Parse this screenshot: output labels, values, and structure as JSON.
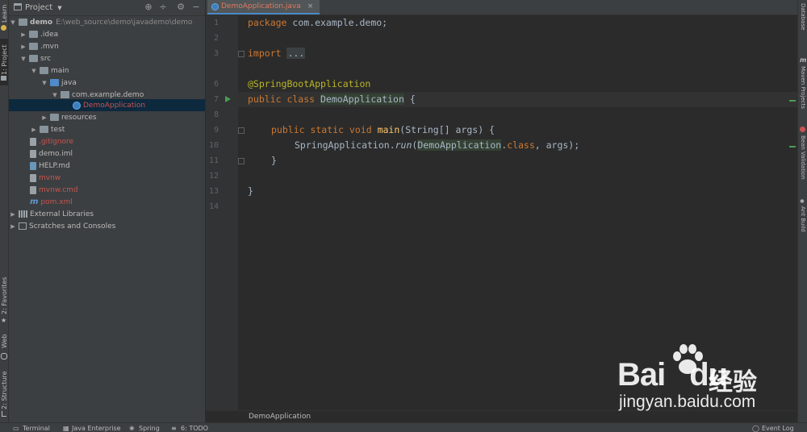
{
  "left_strip": {
    "tabs": [
      {
        "id": "learn",
        "label": "Learn"
      },
      {
        "id": "project",
        "label": "1: Project"
      },
      {
        "id": "favorites",
        "label": "2: Favorites"
      },
      {
        "id": "web",
        "label": "Web"
      },
      {
        "id": "structure",
        "label": "2: Structure"
      }
    ]
  },
  "project_panel": {
    "title": "Project",
    "tree": [
      {
        "label": "demo",
        "path": "E:\\web_source\\demo\\javademo\\demo",
        "icon": "folder-icon"
      },
      {
        "label": ".idea",
        "icon": "folder-icon"
      },
      {
        "label": ".mvn",
        "icon": "folder-icon"
      },
      {
        "label": "src",
        "icon": "folder-icon"
      },
      {
        "label": "main",
        "icon": "folder-icon"
      },
      {
        "label": "java",
        "icon": "source-folder-icon"
      },
      {
        "label": "com.example.demo",
        "icon": "package-icon"
      },
      {
        "label": "DemoApplication",
        "icon": "spring-boot-class-icon"
      },
      {
        "label": "resources",
        "icon": "resources-folder-icon"
      },
      {
        "label": "test",
        "icon": "folder-icon"
      },
      {
        "label": ".gitignore",
        "icon": "file-icon"
      },
      {
        "label": "demo.iml",
        "icon": "file-icon"
      },
      {
        "label": "HELP.md",
        "icon": "markdown-file-icon"
      },
      {
        "label": "mvnw",
        "icon": "file-icon"
      },
      {
        "label": "mvnw.cmd",
        "icon": "file-icon"
      },
      {
        "label": "pom.xml",
        "icon": "maven-file-icon"
      },
      {
        "label": "External Libraries",
        "icon": "libraries-icon"
      },
      {
        "label": "Scratches and Consoles",
        "icon": "scratches-icon"
      }
    ]
  },
  "editor": {
    "tab_label": "DemoApplication.java",
    "line_numbers": [
      "1",
      "2",
      "3",
      "6",
      "7",
      "8",
      "9",
      "10",
      "11",
      "12",
      "13",
      "14"
    ],
    "code": {
      "l1_kw": "package",
      "l1_rest": " com.example.demo;",
      "l3_kw": "import",
      "l3_fold": "...",
      "l6_ann": "@SpringBootApplication",
      "l7_kw": "public class",
      "l7_name": "DemoApplication",
      "l7_rest": " {",
      "l9_kw": "public static void",
      "l9_fn": "main",
      "l9_rest": "(String[] args) {",
      "l10_a": "SpringApplication.",
      "l10_run": "run",
      "l10_paren": "(",
      "l10_cls": "DemoApplication",
      "l10_dot": ".",
      "l10_kw": "class",
      "l10_rest": ", args);",
      "l11": "}",
      "l13": "}"
    },
    "breadcrumb": "DemoApplication"
  },
  "right_strip": {
    "tabs": [
      "Database",
      "Maven Projects",
      "Bean Validation",
      "Ant Build"
    ]
  },
  "bottom_bar": {
    "items": [
      "Terminal",
      "Java Enterprise",
      "Spring",
      "6: TODO",
      "Event Log"
    ]
  },
  "watermark": {
    "brand": "Bai",
    "brand2": "du",
    "cn": "经验",
    "url": "jingyan.baidu.com"
  },
  "colors": {
    "accent": "#4a88c7",
    "keyword": "#cc7832",
    "annotation": "#bbb529",
    "method": "#ffc66d",
    "background": "#2b2b2b"
  }
}
